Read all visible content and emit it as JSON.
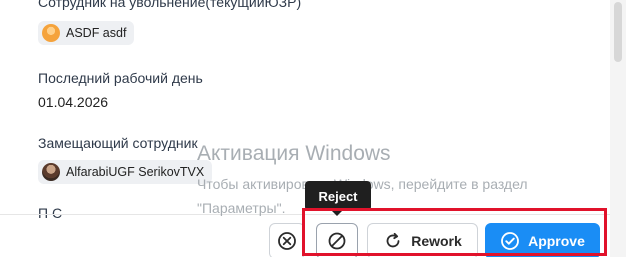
{
  "form": {
    "employee_label": "Сотрудник на увольнение(текущийЮЗР)",
    "employee_chip": "ASDF asdf",
    "last_day_label": "Последний рабочий день",
    "last_day_value": "01.04.2026",
    "replacement_label": "Замещающий сотрудник",
    "replacement_chip": "AlfarabiUGF SerikovTVX",
    "partial_label": "П   С"
  },
  "watermark": {
    "title": "Активация Windows",
    "line1": "Чтобы активировать Windows, перейдите в раздел",
    "line2": "\"Параметры\"."
  },
  "actions": {
    "tooltip": "Reject",
    "rework_label": "Rework",
    "approve_label": "Approve"
  },
  "colors": {
    "approve_bg": "#1a8df5",
    "highlight_border": "#e1122b",
    "tooltip_bg": "#1f1f1f"
  },
  "icons": {
    "close": "close-circle-icon",
    "reject": "block-icon",
    "rework": "rework-icon",
    "approve": "check-circle-icon"
  }
}
